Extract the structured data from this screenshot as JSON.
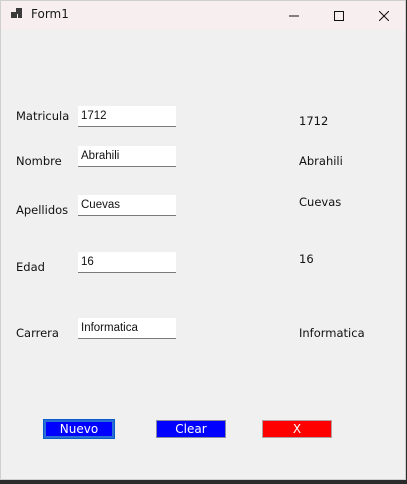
{
  "window": {
    "title": "Form1"
  },
  "form": {
    "labels": {
      "matricula": "Matricula",
      "nombre": "Nombre",
      "apellidos": "Apellidos",
      "edad": "Edad",
      "carrera": "Carrera"
    },
    "inputs": {
      "matricula": "1712",
      "nombre": "Abrahili",
      "apellidos": "Cuevas",
      "edad": "16",
      "carrera": "Informatica"
    },
    "outputs": {
      "matricula": "1712",
      "nombre": "Abrahili",
      "apellidos": "Cuevas",
      "edad": "16",
      "carrera": "Informatica"
    }
  },
  "buttons": {
    "nuevo": "Nuevo",
    "clear": "Clear",
    "x": "X"
  },
  "colors": {
    "blue_button": "#0000ff",
    "red_button": "#ff0000",
    "form_bg": "#f0f0f0"
  }
}
